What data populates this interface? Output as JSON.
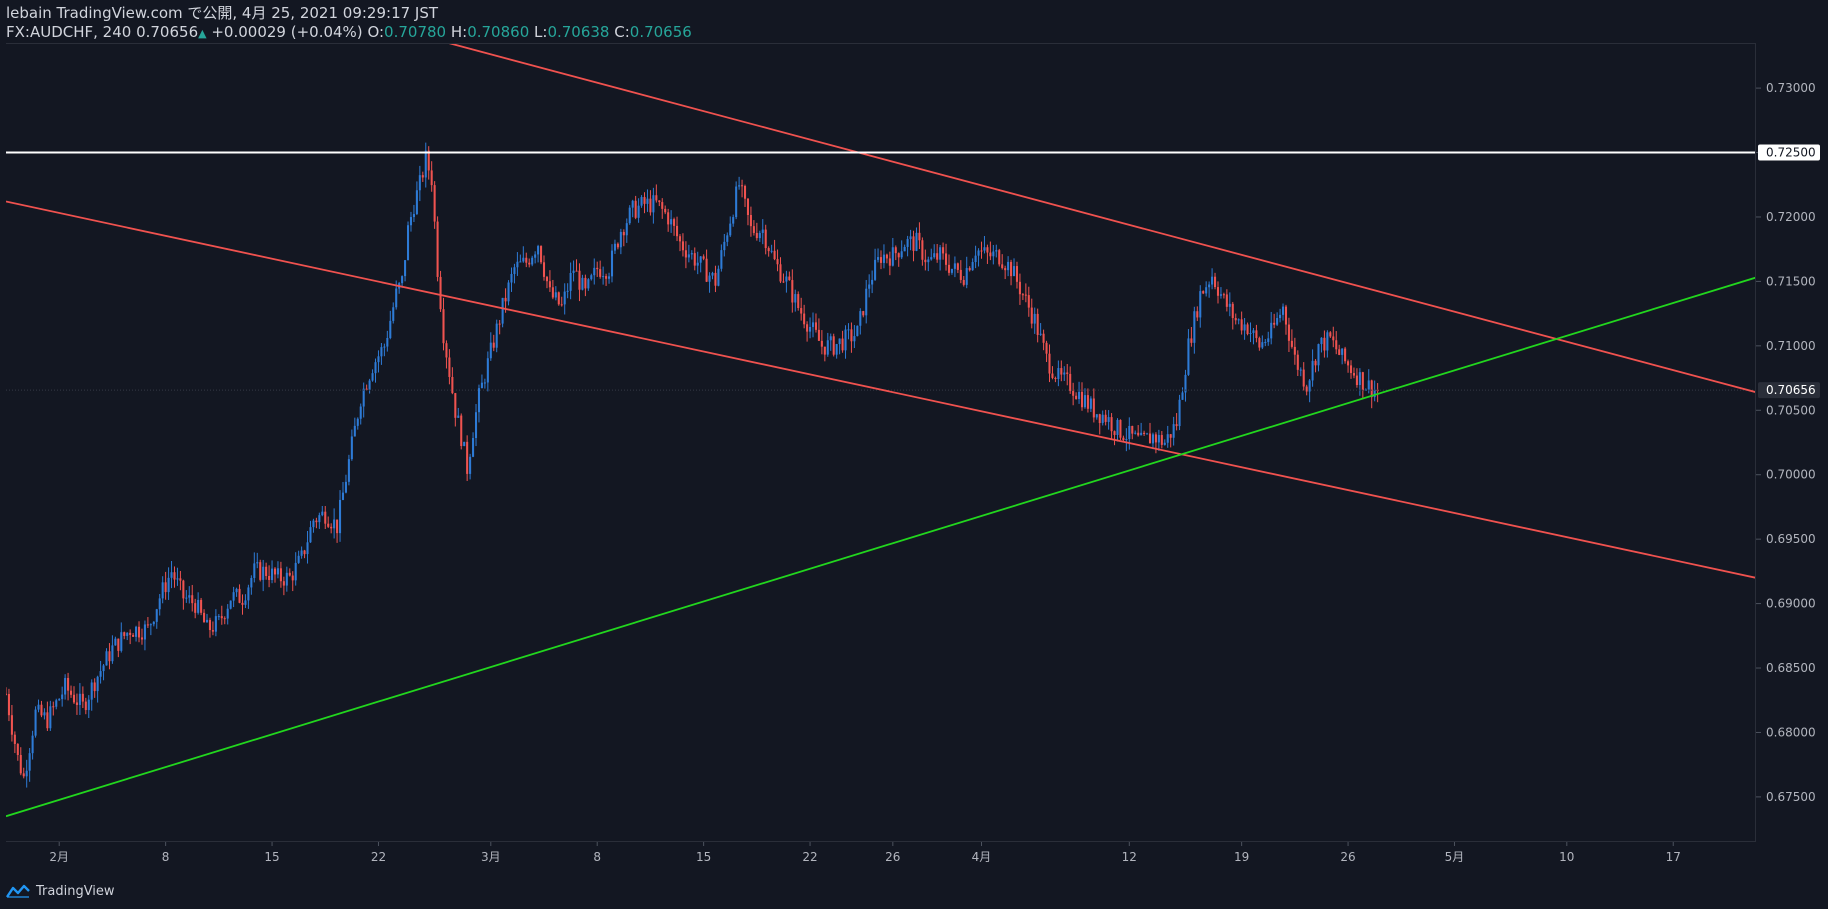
{
  "header": {
    "line1": "lebain TradingView.com で公開, 4月 25, 2021 09:29:17 JST",
    "symbol": "FX:AUDCHF, 240",
    "last": "0.70656",
    "change": "+0.00029 (+0.04%)",
    "o_label": "O:",
    "o_value": "0.70780",
    "h_label": "H:",
    "h_value": "0.70860",
    "l_label": "L:",
    "l_value": "0.70638",
    "c_label": "C:",
    "c_value": "0.70656"
  },
  "footer": {
    "brand": "TradingView",
    "logo_icon": "tradingview-logo-icon"
  },
  "colors": {
    "background": "#131722",
    "up": "#2e7bd6",
    "down": "#ef5350",
    "channel": "#f0524f",
    "support": "#22d61e",
    "resistance_h": "#ffffff",
    "axis_text": "#b2b5be"
  },
  "chart_data": {
    "type": "candlestick",
    "symbol": "FX:AUDCHF",
    "interval": "240",
    "ylim": [
      0.6715,
      0.7335
    ],
    "y_ticks": [
      "0.67500",
      "0.68000",
      "0.68500",
      "0.69000",
      "0.69500",
      "0.70000",
      "0.70500",
      "0.71000",
      "0.71500",
      "0.72000",
      "0.72500",
      "0.73000"
    ],
    "x_ticks": [
      "2月",
      "8",
      "15",
      "22",
      "3月",
      "8",
      "15",
      "22",
      "26",
      "4月",
      "12",
      "19",
      "26",
      "5月",
      "10",
      "17"
    ],
    "price_labels": [
      {
        "label": "0.72500",
        "value": 0.725,
        "style": "white"
      },
      {
        "label": "0.70656",
        "value": 0.70656,
        "style": "last"
      }
    ],
    "close_path": [
      [
        0,
        0.683
      ],
      [
        2,
        0.678
      ],
      [
        3,
        0.6765
      ],
      [
        5,
        0.6815
      ],
      [
        7,
        0.681
      ],
      [
        10,
        0.6835
      ],
      [
        13,
        0.682
      ],
      [
        15,
        0.684
      ],
      [
        18,
        0.6865
      ],
      [
        21,
        0.688
      ],
      [
        24,
        0.688
      ],
      [
        26,
        0.6905
      ],
      [
        28,
        0.6925
      ],
      [
        30,
        0.6905
      ],
      [
        32,
        0.69
      ],
      [
        34,
        0.688
      ],
      [
        36,
        0.6885
      ],
      [
        38,
        0.6905
      ],
      [
        40,
        0.6905
      ],
      [
        42,
        0.6925
      ],
      [
        44,
        0.6925
      ],
      [
        46,
        0.692
      ],
      [
        48,
        0.692
      ],
      [
        50,
        0.6935
      ],
      [
        52,
        0.6965
      ],
      [
        54,
        0.697
      ],
      [
        56,
        0.696
      ],
      [
        58,
        0.701
      ],
      [
        60,
        0.706
      ],
      [
        62,
        0.7085
      ],
      [
        64,
        0.71
      ],
      [
        66,
        0.714
      ],
      [
        67,
        0.715
      ],
      [
        68,
        0.719
      ],
      [
        69,
        0.721
      ],
      [
        70,
        0.7225
      ],
      [
        71,
        0.7245
      ],
      [
        72,
        0.723
      ],
      [
        73,
        0.716
      ],
      [
        74,
        0.711
      ],
      [
        75,
        0.708
      ],
      [
        76,
        0.705
      ],
      [
        77,
        0.703
      ],
      [
        78,
        0.7005
      ],
      [
        79,
        0.7035
      ],
      [
        80,
        0.706
      ],
      [
        82,
        0.7095
      ],
      [
        84,
        0.713
      ],
      [
        86,
        0.716
      ],
      [
        88,
        0.7165
      ],
      [
        90,
        0.718
      ],
      [
        92,
        0.714
      ],
      [
        94,
        0.713
      ],
      [
        96,
        0.716
      ],
      [
        98,
        0.714
      ],
      [
        100,
        0.716
      ],
      [
        102,
        0.716
      ],
      [
        104,
        0.719
      ],
      [
        106,
        0.7205
      ],
      [
        108,
        0.721
      ],
      [
        110,
        0.721
      ],
      [
        112,
        0.72
      ],
      [
        114,
        0.718
      ],
      [
        116,
        0.717
      ],
      [
        118,
        0.716
      ],
      [
        120,
        0.715
      ],
      [
        122,
        0.719
      ],
      [
        124,
        0.7225
      ],
      [
        126,
        0.719
      ],
      [
        128,
        0.719
      ],
      [
        130,
        0.7165
      ],
      [
        132,
        0.715
      ],
      [
        134,
        0.713
      ],
      [
        136,
        0.7115
      ],
      [
        138,
        0.71
      ],
      [
        140,
        0.71
      ],
      [
        142,
        0.7105
      ],
      [
        144,
        0.711
      ],
      [
        146,
        0.715
      ],
      [
        148,
        0.717
      ],
      [
        150,
        0.717
      ],
      [
        152,
        0.718
      ],
      [
        154,
        0.718
      ],
      [
        156,
        0.7165
      ],
      [
        158,
        0.717
      ],
      [
        160,
        0.716
      ],
      [
        162,
        0.7155
      ],
      [
        164,
        0.7175
      ],
      [
        166,
        0.717
      ],
      [
        168,
        0.717
      ],
      [
        170,
        0.716
      ],
      [
        172,
        0.714
      ],
      [
        174,
        0.712
      ],
      [
        176,
        0.709
      ],
      [
        178,
        0.7075
      ],
      [
        180,
        0.707
      ],
      [
        182,
        0.706
      ],
      [
        184,
        0.705
      ],
      [
        186,
        0.7045
      ],
      [
        188,
        0.7035
      ],
      [
        190,
        0.703
      ],
      [
        192,
        0.7025
      ],
      [
        194,
        0.703
      ],
      [
        196,
        0.7025
      ],
      [
        198,
        0.704
      ],
      [
        200,
        0.71
      ],
      [
        202,
        0.714
      ],
      [
        204,
        0.7155
      ],
      [
        206,
        0.7135
      ],
      [
        208,
        0.712
      ],
      [
        210,
        0.7115
      ],
      [
        212,
        0.71
      ],
      [
        214,
        0.711
      ],
      [
        216,
        0.713
      ],
      [
        218,
        0.709
      ],
      [
        220,
        0.707
      ],
      [
        222,
        0.71
      ],
      [
        224,
        0.7105
      ],
      [
        226,
        0.709
      ],
      [
        228,
        0.708
      ],
      [
        230,
        0.707
      ],
      [
        232,
        0.7065
      ]
    ],
    "trendlines": [
      {
        "name": "channel-upper",
        "points": [
          [
            52,
            0.7363
          ],
          [
            296,
            0.7064
          ]
        ]
      },
      {
        "name": "channel-lower",
        "points": [
          [
            0,
            0.7212
          ],
          [
            296,
            0.692
          ]
        ]
      },
      {
        "name": "support",
        "points": [
          [
            0,
            0.6735
          ],
          [
            296,
            0.7153
          ]
        ]
      },
      {
        "name": "horizontal-resistance",
        "points": [
          [
            0,
            0.725
          ],
          [
            296,
            0.725
          ]
        ]
      }
    ],
    "x_domain": [
      0,
      296
    ],
    "x_tick_positions": [
      9,
      27,
      45,
      63,
      82,
      100,
      118,
      136,
      150,
      165,
      190,
      209,
      227,
      245,
      264,
      282
    ]
  }
}
